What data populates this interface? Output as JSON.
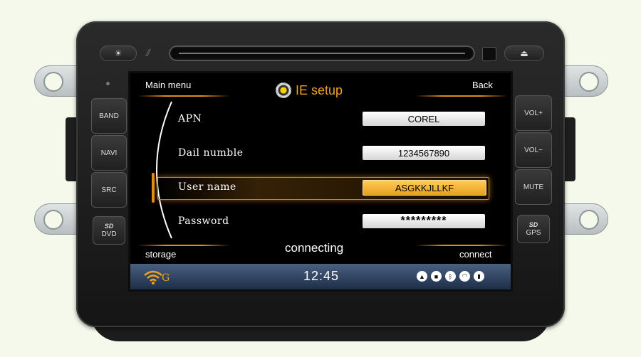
{
  "hardware": {
    "left_buttons": [
      "BAND",
      "NAVI",
      "SRC"
    ],
    "right_buttons": [
      "VOL+",
      "VOL−",
      "MUTE"
    ],
    "sd_left": {
      "icon": "SD",
      "label": "DVD"
    },
    "sd_right": {
      "icon": "SD",
      "label": "GPS"
    },
    "sun_icon": "☀",
    "eject_icon": "⏏"
  },
  "screen": {
    "main_menu": "Main menu",
    "back": "Back",
    "title": "IE setup",
    "title_icon": "gear-icon",
    "rows": [
      {
        "label": "APN",
        "value": "COREL",
        "selected": false
      },
      {
        "label": "Dail numble",
        "value": "1234567890",
        "selected": false
      },
      {
        "label": "User name",
        "value": "ASGKKJLLKF",
        "selected": true
      },
      {
        "label": "Password",
        "value": "*********",
        "selected": false
      }
    ],
    "status": "connecting",
    "storage": "storage",
    "connect": "connect"
  },
  "statusbar": {
    "clock": "12:45",
    "logo_letter": "G",
    "icons": [
      "navigation-icon",
      "camera-icon",
      "bluetooth-icon",
      "wifi-icon",
      "signal-icon"
    ]
  },
  "colors": {
    "accent": "#e88a18",
    "title": "#f0a020",
    "selected_field": "#f0b030"
  }
}
